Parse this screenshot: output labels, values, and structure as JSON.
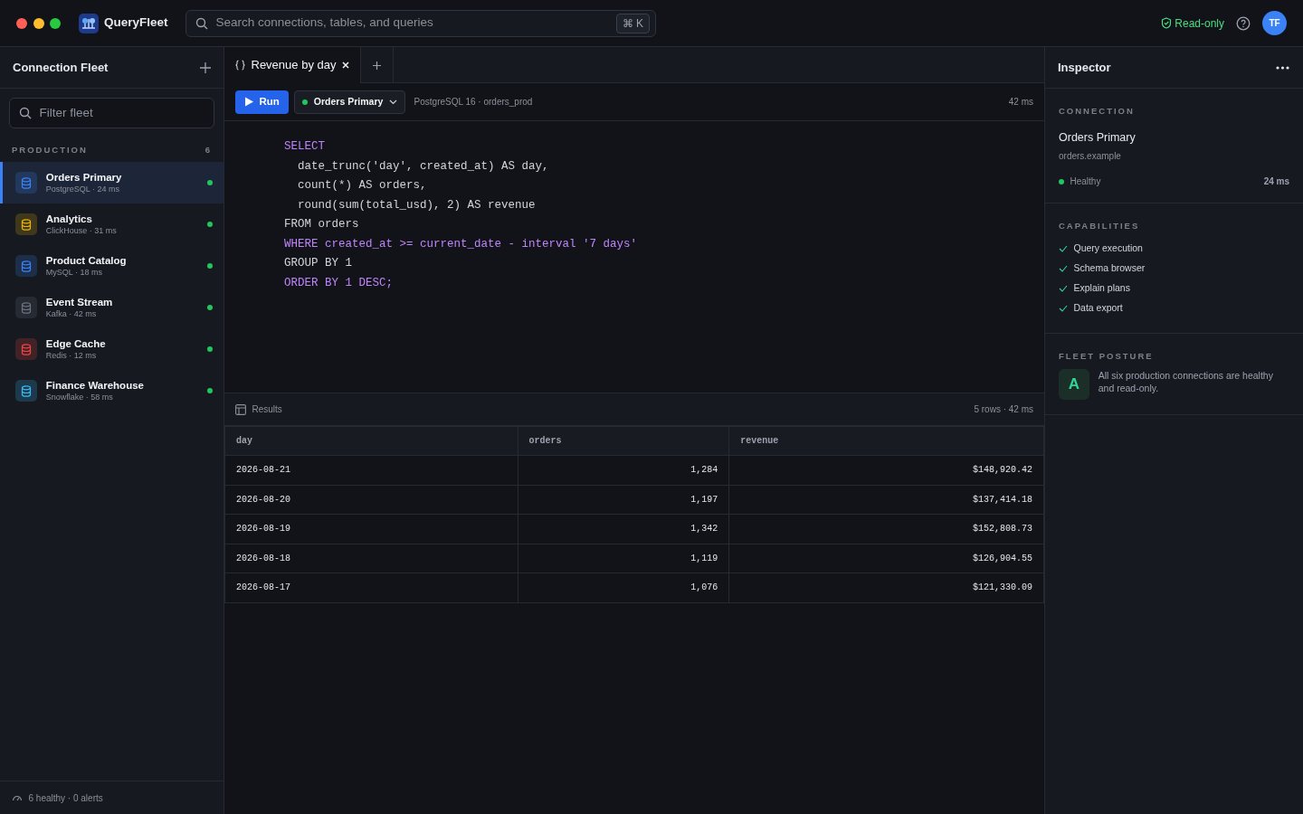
{
  "app": {
    "name": "QueryFleet",
    "search": {
      "placeholder": "Search connections, tables, and queries",
      "shortcut": "⌘ K"
    },
    "mode": "Read-only",
    "avatar": "TF"
  },
  "sidebar": {
    "title": "Connection Fleet",
    "filter": {
      "placeholder": "Filter fleet"
    },
    "group": {
      "label": "PRODUCTION",
      "count": "6"
    },
    "items": [
      {
        "name": "Orders Primary",
        "meta": "PostgreSQL · 24 ms",
        "color": "#3b82f6",
        "online": true,
        "selected": true
      },
      {
        "name": "Analytics",
        "meta": "ClickHouse · 31 ms",
        "color": "#eab308",
        "online": true,
        "selected": false
      },
      {
        "name": "Product Catalog",
        "meta": "MySQL · 18 ms",
        "color": "#3b82f6",
        "online": true,
        "selected": false
      },
      {
        "name": "Event Stream",
        "meta": "Kafka · 42 ms",
        "color": "#6b7280",
        "online": true,
        "selected": false
      },
      {
        "name": "Edge Cache",
        "meta": "Redis · 12 ms",
        "color": "#ef4444",
        "online": true,
        "selected": false
      },
      {
        "name": "Finance Warehouse",
        "meta": "Snowflake · 58 ms",
        "color": "#38bdf8",
        "online": true,
        "selected": false
      }
    ],
    "footer": "6 healthy · 0 alerts"
  },
  "editor": {
    "tabs": [
      {
        "label": "Revenue by day",
        "selected": true
      }
    ],
    "run": "Run",
    "connection": "Orders Primary",
    "engine": "PostgreSQL 16 · orders_prod",
    "timing": "42 ms",
    "code": [
      {
        "text": "SELECT",
        "kind": "keyword"
      },
      {
        "text": "  date_trunc('day', created_at) AS day,",
        "kind": "plain"
      },
      {
        "text": "  count(*) AS orders,",
        "kind": "plain"
      },
      {
        "text": "  round(sum(total_usd), 2) AS revenue",
        "kind": "plain"
      },
      {
        "text": "FROM orders",
        "kind": "plain"
      },
      {
        "text": "WHERE created_at >= current_date - interval '7 days'",
        "kind": "keyword"
      },
      {
        "text": "GROUP BY 1",
        "kind": "plain"
      },
      {
        "text": "ORDER BY 1 DESC;",
        "kind": "keyword"
      }
    ]
  },
  "results": {
    "title": "Results",
    "summary": "5 rows · 42 ms",
    "columns": [
      "day",
      "orders",
      "revenue"
    ],
    "rows": [
      [
        "2026-08-21",
        "1,284",
        "$148,920.42"
      ],
      [
        "2026-08-20",
        "1,197",
        "$137,414.18"
      ],
      [
        "2026-08-19",
        "1,342",
        "$152,808.73"
      ],
      [
        "2026-08-18",
        "1,119",
        "$126,904.55"
      ],
      [
        "2026-08-17",
        "1,076",
        "$121,330.09"
      ]
    ]
  },
  "inspector": {
    "title": "Inspector",
    "connection": {
      "heading": "CONNECTION",
      "name": "Orders Primary",
      "host": "orders.example",
      "status": "Healthy",
      "latency": "24 ms"
    },
    "capabilities": {
      "heading": "CAPABILITIES",
      "items": [
        "Query execution",
        "Schema browser",
        "Explain plans",
        "Data export"
      ]
    },
    "posture": {
      "heading": "FLEET POSTURE",
      "grade": "A",
      "text": "All six production connections are healthy and read-only."
    }
  }
}
